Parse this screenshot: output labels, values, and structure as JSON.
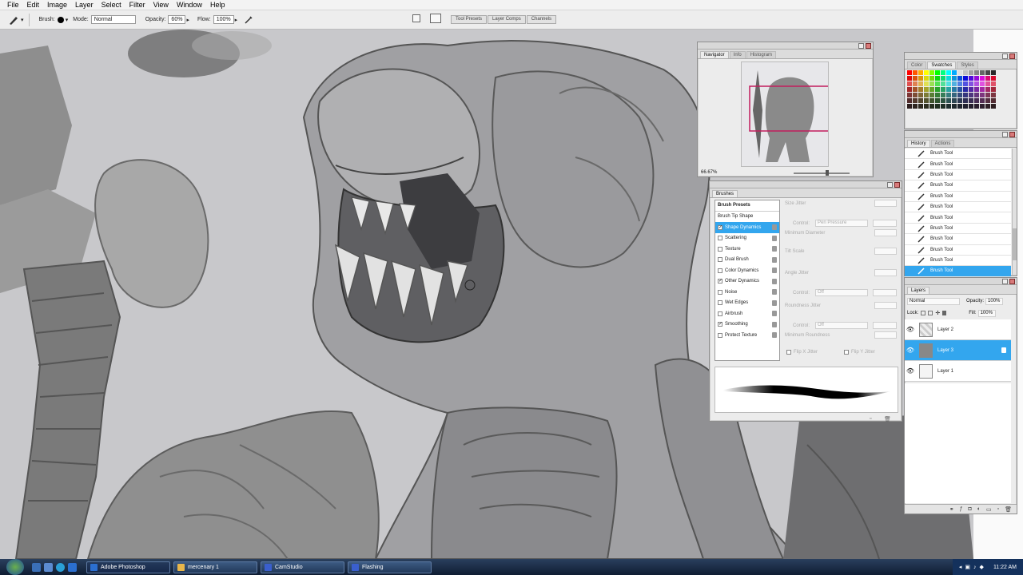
{
  "menu": [
    "File",
    "Edit",
    "Image",
    "Layer",
    "Select",
    "Filter",
    "View",
    "Window",
    "Help"
  ],
  "options_bar": {
    "brush_label": "Brush:",
    "mode_label": "Mode:",
    "mode_value": "Normal",
    "opacity_label": "Opacity:",
    "opacity_value": "60%",
    "flow_label": "Flow:",
    "flow_value": "100%",
    "well_tabs": [
      "Tool Presets",
      "Layer Comps",
      "Channels"
    ]
  },
  "navigator": {
    "tabs": [
      "Navigator",
      "Info",
      "Histogram"
    ],
    "zoom": "66.67%"
  },
  "color_panel": {
    "tabs": [
      "Color",
      "Swatches",
      "Styles"
    ]
  },
  "history": {
    "tabs": [
      "History",
      "Actions"
    ],
    "items": [
      "Brush Tool",
      "Brush Tool",
      "Brush Tool",
      "Brush Tool",
      "Brush Tool",
      "Brush Tool",
      "Brush Tool",
      "Brush Tool",
      "Brush Tool",
      "Brush Tool",
      "Brush Tool",
      "Brush Tool"
    ],
    "selected_index": 11
  },
  "brushes": {
    "title": "Brushes",
    "presets_label": "Brush Presets",
    "tip_shape_label": "Brush Tip Shape",
    "options": [
      {
        "label": "Shape Dynamics",
        "checked": true,
        "selected": true
      },
      {
        "label": "Scattering",
        "checked": false
      },
      {
        "label": "Texture",
        "checked": false
      },
      {
        "label": "Dual Brush",
        "checked": false
      },
      {
        "label": "Color Dynamics",
        "checked": false
      },
      {
        "label": "Other Dynamics",
        "checked": true
      },
      {
        "label": "Noise",
        "checked": false
      },
      {
        "label": "Wet Edges",
        "checked": false
      },
      {
        "label": "Airbrush",
        "checked": false
      },
      {
        "label": "Smoothing",
        "checked": true
      },
      {
        "label": "Protect Texture",
        "checked": false
      }
    ],
    "right": {
      "size_jitter": "Size Jitter",
      "control": "Control:",
      "control_value_1": "Pen Pressure",
      "min_diameter": "Minimum Diameter",
      "tilt_scale": "Tilt Scale",
      "angle_jitter": "Angle Jitter",
      "control_value_2": "Off",
      "roundness_jitter": "Roundness Jitter",
      "control_value_3": "Off",
      "min_roundness": "Minimum Roundness",
      "flip_x": "Flip X Jitter",
      "flip_y": "Flip Y Jitter"
    }
  },
  "layers": {
    "tab": "Layers",
    "blend_mode": "Normal",
    "opacity_label": "Opacity:",
    "opacity_value": "100%",
    "lock_label": "Lock:",
    "fill_label": "Fill:",
    "fill_value": "100%",
    "items": [
      {
        "name": "Layer 2",
        "selected": false
      },
      {
        "name": "Layer 3",
        "selected": true
      },
      {
        "name": "Layer 1",
        "selected": false
      }
    ]
  },
  "taskbar": {
    "buttons": [
      {
        "label": "Adobe Photoshop",
        "color": "#2b6fd0"
      },
      {
        "label": "mercenary 1",
        "color": "#e8b64a"
      },
      {
        "label": "CamStudio",
        "color": "#3a5fcd"
      },
      {
        "label": "Flashing",
        "color": "#3a5fcd"
      }
    ],
    "clock": "11:22 AM"
  },
  "colors": {
    "selection": "#33a6ee",
    "canvas_bg": "#c9c9cc"
  }
}
